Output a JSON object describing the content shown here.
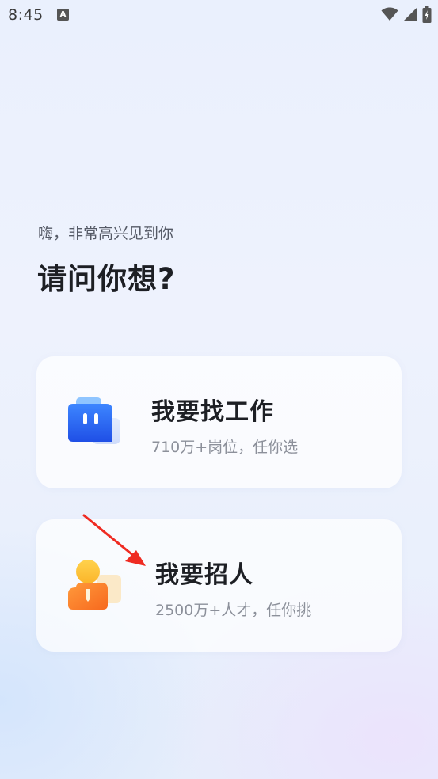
{
  "status_bar": {
    "time": "8:45",
    "notification_icon": "a-icon",
    "icons": [
      "wifi-icon",
      "signal-icon",
      "battery-charging-icon"
    ]
  },
  "greeting": {
    "subtitle": "嗨，非常高兴见到你",
    "title": "请问你想?"
  },
  "options": {
    "job_seeker": {
      "title": "我要找工作",
      "subtitle": "710万+岗位，任你选",
      "icon": "briefcase-chat-icon"
    },
    "recruiter": {
      "title": "我要招人",
      "subtitle": "2500万+人才，任你挑",
      "icon": "person-tie-icon"
    }
  },
  "colors": {
    "job_icon_blue": "#2f6dfb",
    "recruit_icon_orange": "#fb7a2a",
    "recruit_icon_yellow": "#fdc23a",
    "annotation_arrow": "#ef2b22"
  }
}
